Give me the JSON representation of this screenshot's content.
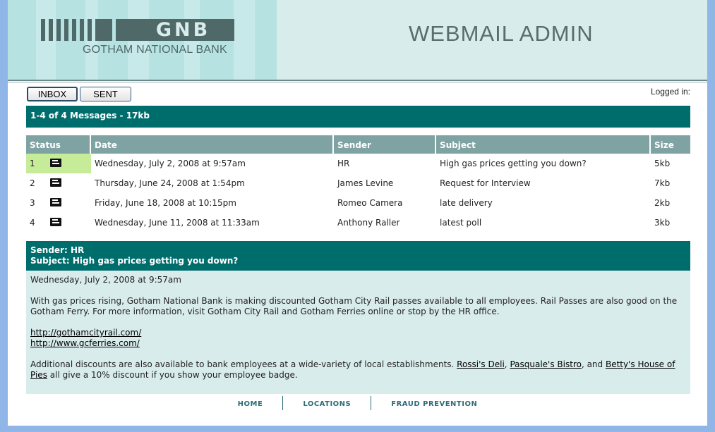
{
  "header": {
    "logo_letters": "GNB",
    "logo_subtitle": "GOTHAM NATIONAL BANK",
    "app_title": "WEBMAIL ADMIN"
  },
  "toolbar": {
    "inbox_label": "INBOX",
    "sent_label": "SENT",
    "logged_in_label": "Logged in:"
  },
  "summary": "1-4 of 4 Messages - 17kb",
  "table": {
    "headers": [
      "Status",
      "Date",
      "Sender",
      "Subject",
      "Size"
    ],
    "rows": [
      {
        "num": "1",
        "date": "Wednesday, July 2, 2008 at 9:57am",
        "sender": "HR",
        "subject": "High gas prices getting you down?",
        "size": "5kb"
      },
      {
        "num": "2",
        "date": "Thursday, June 24, 2008 at 1:54pm",
        "sender": "James Levine",
        "subject": "Request for Interview",
        "size": "7kb"
      },
      {
        "num": "3",
        "date": "Friday, June 18, 2008 at 10:15pm",
        "sender": "Romeo Camera",
        "subject": "late delivery",
        "size": "2kb"
      },
      {
        "num": "4",
        "date": "Wednesday, June 11, 2008 at 11:33am",
        "sender": "Anthony Raller",
        "subject": "latest poll",
        "size": "3kb"
      }
    ]
  },
  "preview": {
    "sender_line": "Sender: HR",
    "subject_line": "Subject: High gas prices getting you down?",
    "date": "Wednesday, July 2, 2008 at 9:57am",
    "para1": "With gas prices rising, Gotham National Bank is making discounted Gotham City Rail passes available to all employees. Rail Passes are also good on the Gotham Ferry. For more information, visit Gotham City Rail and Gotham Ferries online or stop by the HR office.",
    "link1": "http://gothamcityrail.com/",
    "link2": "http://www.gcferries.com/",
    "para2_start": "Additional discounts are also available to bank employees at a wide-variety of local establishments. ",
    "shop1": "Rossi's Deli",
    "comma": ", ",
    "shop2": "Pasquale's Bistro",
    "and": ", and ",
    "shop3": "Betty's House of Pies",
    "para2_end": " all give a 10% discount if you show your employee badge."
  },
  "footer": {
    "home": "HOME",
    "locations": "LOCATIONS",
    "fraud": "FRAUD PREVENTION"
  },
  "colors": {
    "teal_bar": "#006d6d",
    "header_bg": "#d8ecec",
    "selected_status": "#c6ec9a",
    "table_header": "#7fa2a2"
  }
}
